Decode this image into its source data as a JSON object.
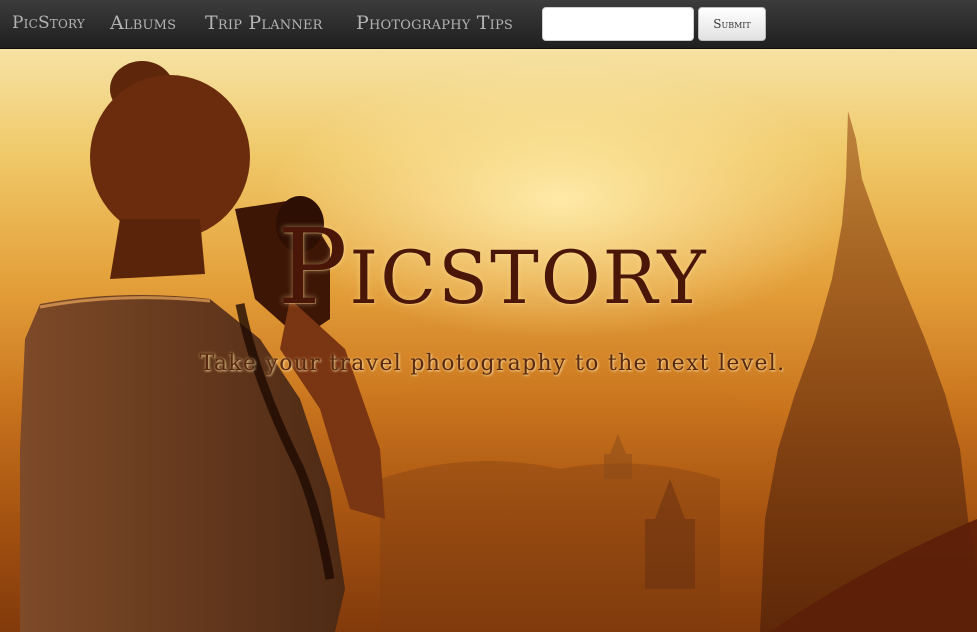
{
  "nav": {
    "brand": "PicStory",
    "links": [
      "Albums",
      "Trip Planner",
      "Photography Tips"
    ],
    "search": {
      "value": "",
      "placeholder": ""
    },
    "submit_label": "Submit"
  },
  "hero": {
    "title": "Picstory",
    "tagline": "Take your travel photography to the next level.",
    "photo_subject": "photographer-at-sunset",
    "colors": {
      "sky": "#f6e2a4",
      "mid": "#e4a03a",
      "ground": "#7a3509",
      "title": "#4a1607"
    }
  },
  "colors": {
    "navbar": "#2a2a2a",
    "nav_text": "#b3b3b3"
  }
}
